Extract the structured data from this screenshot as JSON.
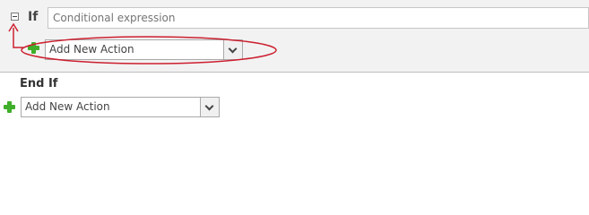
{
  "if_block": {
    "keyword": "If",
    "condition_placeholder": "Conditional expression",
    "add_action": {
      "selected": "Add New Action"
    }
  },
  "end_block": {
    "keyword": "End If",
    "add_action": {
      "selected": "Add New Action"
    }
  },
  "icons": {
    "collapse": "collapse-minus-icon",
    "add": "green-plus-icon",
    "dropdown": "chevron-down-icon"
  },
  "colors": {
    "annotation": "#cc1f2f",
    "plus": "#3fae2a",
    "block_background": "#f2f2f2"
  }
}
